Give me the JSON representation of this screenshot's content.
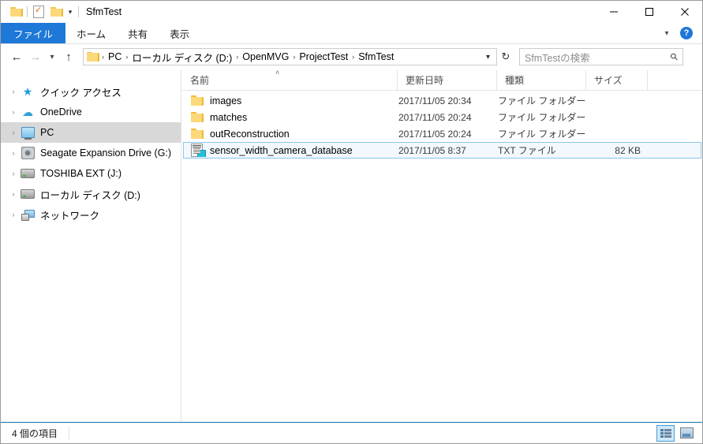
{
  "window": {
    "title": "SfmTest",
    "quick_access": [
      "folder-icon",
      "properties-icon",
      "new-folder-icon",
      "customize-chevron-icon"
    ],
    "controls": {
      "minimize": "—",
      "maximize": "□",
      "close": "✕"
    }
  },
  "ribbon": {
    "tabs": [
      {
        "label": "ファイル",
        "active": true
      },
      {
        "label": "ホーム",
        "active": false
      },
      {
        "label": "共有",
        "active": false
      },
      {
        "label": "表示",
        "active": false
      }
    ],
    "collapse_chevron": "∨",
    "help_label": "?"
  },
  "address": {
    "back": "←",
    "forward": "→",
    "history": "∨",
    "up": "↑",
    "crumbs": [
      "PC",
      "ローカル ディスク (D:)",
      "OpenMVG",
      "ProjectTest",
      "SfmTest"
    ],
    "separator": "›",
    "dropdown": "∨",
    "refresh": "↻"
  },
  "search": {
    "placeholder": "SfmTestの検索",
    "icon": "search-icon"
  },
  "sidebar": {
    "items": [
      {
        "label": "クイック アクセス",
        "icon": "star-icon",
        "selected": false
      },
      {
        "label": "OneDrive",
        "icon": "cloud-icon",
        "selected": false
      },
      {
        "label": "PC",
        "icon": "computer-icon",
        "selected": true
      },
      {
        "label": "Seagate Expansion Drive (G:)",
        "icon": "external-drive-icon",
        "selected": false
      },
      {
        "label": "TOSHIBA EXT (J:)",
        "icon": "drive-icon",
        "selected": false
      },
      {
        "label": "ローカル ディスク (D:)",
        "icon": "drive-icon",
        "selected": false
      },
      {
        "label": "ネットワーク",
        "icon": "network-icon",
        "selected": false
      }
    ],
    "expand_chevron": "›"
  },
  "filelist": {
    "columns": [
      {
        "key": "name",
        "label": "名前",
        "sorted": "asc",
        "sort_caret": "˄"
      },
      {
        "key": "date",
        "label": "更新日時"
      },
      {
        "key": "type",
        "label": "種類"
      },
      {
        "key": "size",
        "label": "サイズ"
      }
    ],
    "rows": [
      {
        "name": "images",
        "date": "2017/11/05 20:34",
        "type": "ファイル フォルダー",
        "size": "",
        "icon": "folder-icon",
        "selected": false
      },
      {
        "name": "matches",
        "date": "2017/11/05 20:24",
        "type": "ファイル フォルダー",
        "size": "",
        "icon": "folder-icon",
        "selected": false
      },
      {
        "name": "outReconstruction",
        "date": "2017/11/05 20:24",
        "type": "ファイル フォルダー",
        "size": "",
        "icon": "folder-icon",
        "selected": false
      },
      {
        "name": "sensor_width_camera_database",
        "date": "2017/11/05 8:37",
        "type": "TXT ファイル",
        "size": "82 KB",
        "icon": "text-file-icon",
        "selected": true
      }
    ]
  },
  "status": {
    "item_count": "4 個の項目",
    "views": [
      {
        "name": "details-view",
        "active": true
      },
      {
        "name": "large-icons-view",
        "active": false
      }
    ]
  },
  "colors": {
    "accent": "#1e78d7",
    "selection_fill": "#f2f8fd",
    "selection_border": "#86c8ef",
    "sidebar_selected": "#d8d8d8",
    "status_top_border": "#1d6fa5"
  }
}
